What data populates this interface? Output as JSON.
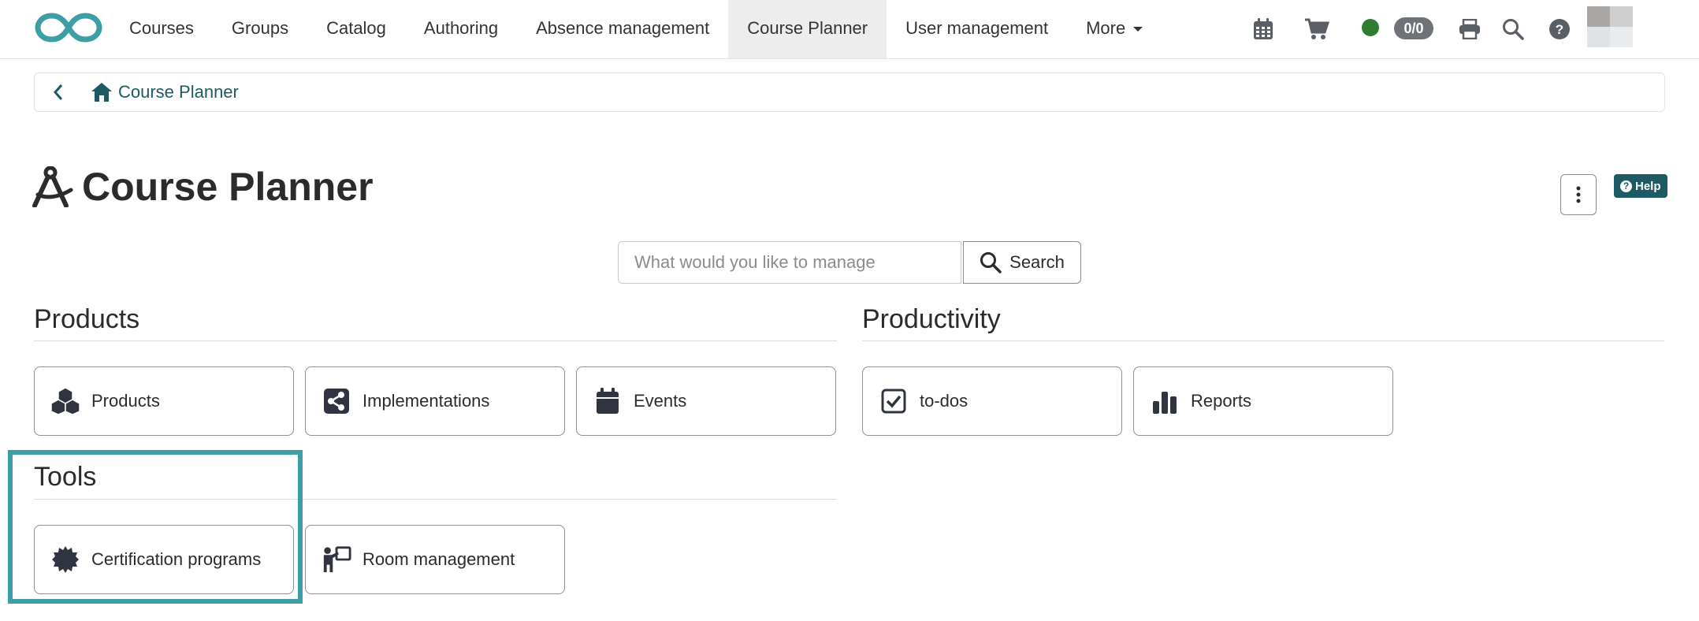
{
  "nav": {
    "items": [
      {
        "label": "Courses",
        "active": false
      },
      {
        "label": "Groups",
        "active": false
      },
      {
        "label": "Catalog",
        "active": false
      },
      {
        "label": "Authoring",
        "active": false
      },
      {
        "label": "Absence management",
        "active": false
      },
      {
        "label": "Course Planner",
        "active": true
      },
      {
        "label": "User management",
        "active": false
      },
      {
        "label": "More",
        "active": false
      }
    ],
    "counter": "0/0",
    "status_color": "#2e7d32"
  },
  "breadcrumb": {
    "label": "Course Planner"
  },
  "page": {
    "title": "Course Planner",
    "help_label": "Help"
  },
  "search": {
    "placeholder": "What would you like to manage",
    "button_label": "Search"
  },
  "sections": {
    "products": {
      "heading": "Products",
      "tiles": [
        {
          "label": "Products",
          "icon": "cubes-icon"
        },
        {
          "label": "Implementations",
          "icon": "share-icon"
        },
        {
          "label": "Events",
          "icon": "calendar-icon"
        }
      ]
    },
    "productivity": {
      "heading": "Productivity",
      "tiles": [
        {
          "label": "to-dos",
          "icon": "checkbox-icon"
        },
        {
          "label": "Reports",
          "icon": "bar-chart-icon"
        }
      ]
    },
    "tools": {
      "heading": "Tools",
      "tiles": [
        {
          "label": "Certification programs",
          "icon": "certificate-icon"
        },
        {
          "label": "Room management",
          "icon": "presenter-icon"
        }
      ]
    }
  },
  "colors": {
    "accent": "#1e5a63",
    "highlight": "#3d9ea6",
    "icon": "#2f3440"
  }
}
